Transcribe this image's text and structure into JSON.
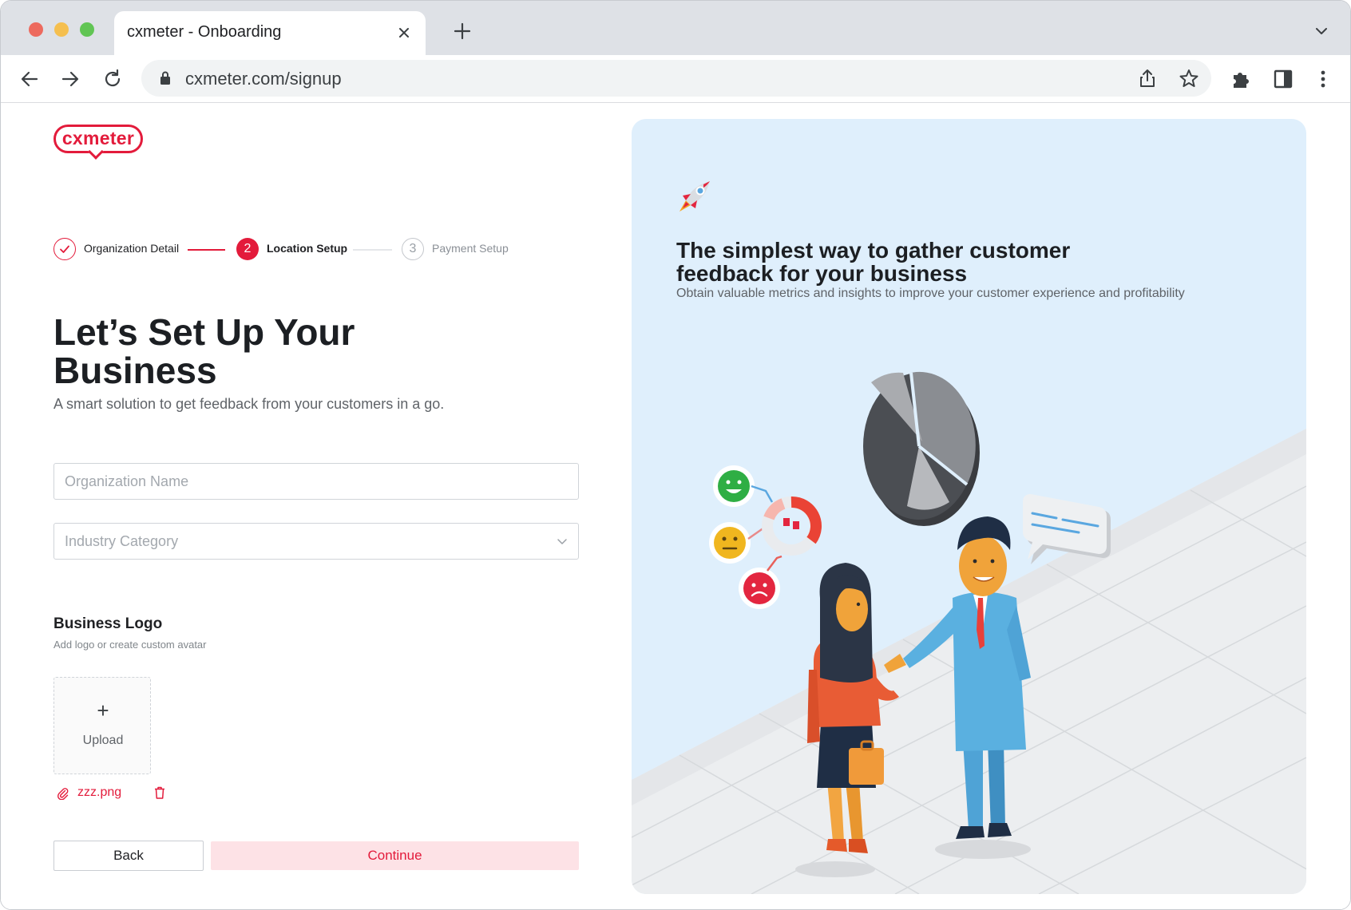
{
  "browser": {
    "tab_title": "cxmeter - Onboarding",
    "url": "cxmeter.com/signup"
  },
  "logo": {
    "text": "cxmeter",
    "color": "#e31b3b"
  },
  "stepper": {
    "steps": [
      {
        "number": "1",
        "label": "Organization Detail",
        "state": "completed"
      },
      {
        "number": "2",
        "label": "Location Setup",
        "state": "active"
      },
      {
        "number": "3",
        "label": "Payment Setup",
        "state": "pending"
      }
    ]
  },
  "form": {
    "title": "Let’s Set Up Your Business",
    "subtitle": "A smart solution to get feedback from your customers in a go.",
    "organization_name": {
      "placeholder": "Organization Name",
      "value": ""
    },
    "industry_category": {
      "placeholder": "Industry Category",
      "value": ""
    },
    "business_logo": {
      "label": "Business Logo",
      "hint": "Add logo or create custom avatar",
      "upload_label": "Upload",
      "upload_plus": "+",
      "file_name": "zzz.png"
    },
    "back_label": "Back",
    "continue_label": "Continue"
  },
  "hero": {
    "title": "The simplest way to gather customer feedback for your business",
    "subtitle": "Obtain valuable metrics and insights to improve your customer experience and profitability"
  },
  "colors": {
    "accent": "#e31b3b",
    "continue_bg": "#fde2e6",
    "hero_bg": "#dfeffc"
  }
}
